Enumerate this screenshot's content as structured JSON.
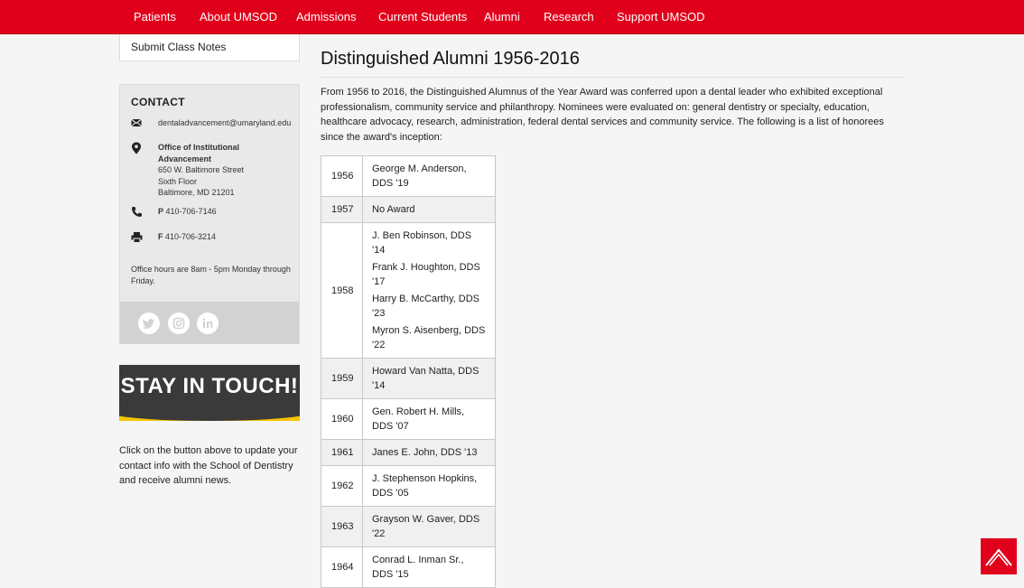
{
  "nav": {
    "items": [
      "Patients",
      "About UMSOD",
      "Admissions",
      "Current Students",
      "Alumni",
      "Research",
      "Support UMSOD"
    ]
  },
  "sidebar": {
    "class_notes": "Submit Class Notes",
    "contact": {
      "heading": "CONTACT",
      "email": "dentaladvancement@umaryland.edu",
      "office_name": "Office of Institutional Advancement",
      "address_line1": "650 W. Baltimore Street",
      "address_line2": "Sixth Floor",
      "address_line3": "Baltimore, MD 21201",
      "phone_label": "P",
      "phone": "410-706-7146",
      "fax_label": "F",
      "fax": "410-706-3214",
      "hours": "Office hours are 8am - 5pm Monday through Friday."
    },
    "social": [
      "twitter-icon",
      "instagram-icon",
      "linkedin-icon"
    ],
    "stay_in_touch": "STAY IN TOUCH!",
    "stay_note": "Click on the button above to update your contact info with the School of Dentistry and receive alumni news."
  },
  "main": {
    "title": "Distinguished Alumni 1956-2016",
    "intro": "From 1956 to 2016, the Distinguished Alumnus of the Year Award was conferred upon a dental leader who exhibited exceptional professionalism, community service and philanthropy. Nominees were evaluated on: general dentistry or specialty, education, healthcare advocacy, research, administration, federal dental services and community service. The following is a list of honorees since the award's inception:",
    "rows": [
      {
        "year": "1956",
        "names": [
          "George M. Anderson, DDS '19"
        ]
      },
      {
        "year": "1957",
        "names": [
          "No Award"
        ]
      },
      {
        "year": "1958",
        "names": [
          "J. Ben Robinson, DDS '14",
          "Frank J. Houghton, DDS '17",
          "Harry B. McCarthy, DDS '23",
          "Myron S. Aisenberg, DDS '22"
        ]
      },
      {
        "year": "1959",
        "names": [
          "Howard Van Natta, DDS '14"
        ]
      },
      {
        "year": "1960",
        "names": [
          "Gen. Robert H. Mills, DDS '07"
        ]
      },
      {
        "year": "1961",
        "names": [
          "Janes E. John, DDS '13"
        ]
      },
      {
        "year": "1962",
        "names": [
          "J. Stephenson Hopkins, DDS '05"
        ]
      },
      {
        "year": "1963",
        "names": [
          "Grayson W. Gaver, DDS '22"
        ]
      },
      {
        "year": "1964",
        "names": [
          "Conrad L. Inman Sr., DDS '15"
        ]
      }
    ]
  },
  "colors": {
    "brand_red": "#e0001b",
    "accent_yellow": "#f5c400"
  }
}
